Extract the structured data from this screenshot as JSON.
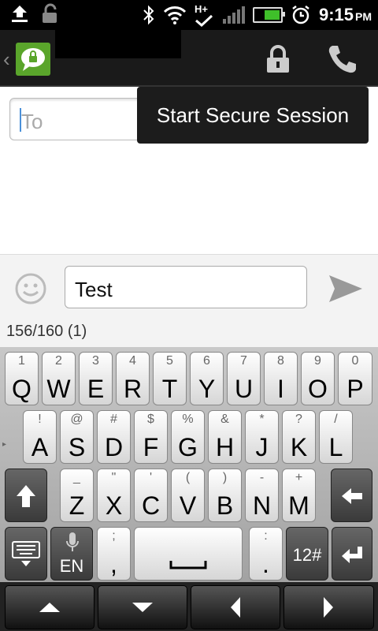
{
  "action_bar": {
    "lock_icon": "lock-icon",
    "call_icon": "phone-icon",
    "app_icon": "secure-chat-icon"
  },
  "compose": {
    "to_placeholder": "To",
    "message_value": "Test",
    "counter": "156/160 (1)"
  },
  "popup": {
    "label": "Start Secure Session"
  },
  "status_bar": {
    "time": "9:15",
    "ampm": "PM",
    "net": "H+"
  },
  "keyboard": {
    "row1": [
      {
        "top": "1",
        "main": "Q"
      },
      {
        "top": "2",
        "main": "W"
      },
      {
        "top": "3",
        "main": "E"
      },
      {
        "top": "4",
        "main": "R"
      },
      {
        "top": "5",
        "main": "T"
      },
      {
        "top": "6",
        "main": "Y"
      },
      {
        "top": "7",
        "main": "U"
      },
      {
        "top": "8",
        "main": "I"
      },
      {
        "top": "9",
        "main": "O"
      },
      {
        "top": "0",
        "main": "P"
      }
    ],
    "row2": [
      {
        "top": "!",
        "main": "A"
      },
      {
        "top": "@",
        "main": "S"
      },
      {
        "top": "#",
        "main": "D"
      },
      {
        "top": "$",
        "main": "F"
      },
      {
        "top": "%",
        "main": "G"
      },
      {
        "top": "&",
        "main": "H"
      },
      {
        "top": "*",
        "main": "J"
      },
      {
        "top": "?",
        "main": "K"
      },
      {
        "top": "/",
        "main": "L"
      }
    ],
    "row3": [
      {
        "top": "_",
        "main": "Z"
      },
      {
        "top": "\"",
        "main": "X"
      },
      {
        "top": "'",
        "main": "C"
      },
      {
        "top": "(",
        "main": "V"
      },
      {
        "top": ")",
        "main": "B"
      },
      {
        "top": "-",
        "main": "N"
      },
      {
        "top": "+",
        "main": "M"
      }
    ],
    "lang_label": "EN",
    "comma_top": ";",
    "comma_main": ",",
    "period_top": ":",
    "period_main": ".",
    "symbols_label": "12#"
  }
}
